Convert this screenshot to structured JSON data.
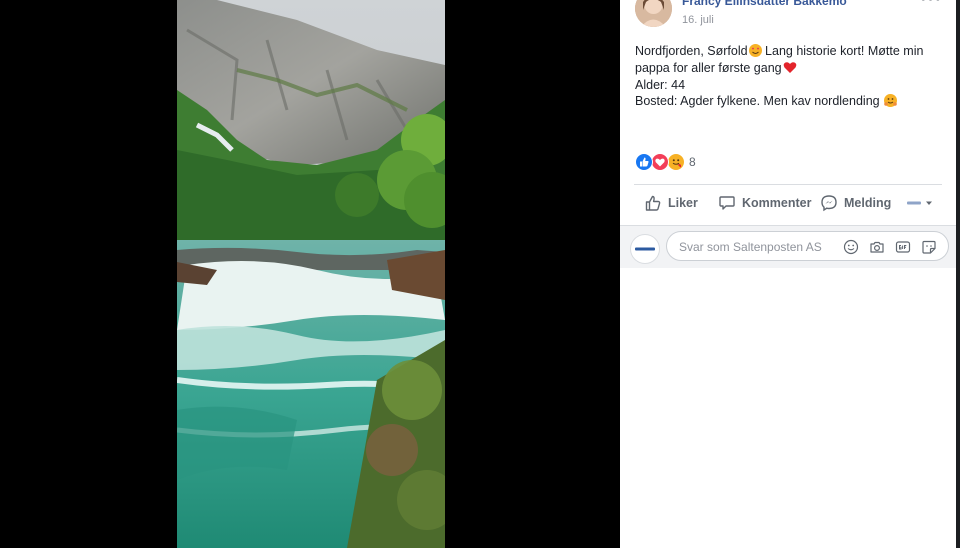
{
  "post": {
    "author": "Francy Ellinsdatter Bakkemo",
    "date": "16. juli",
    "line1_a": "Nordfjorden, Sørfold",
    "line1_b": " Lang historie kort! Møtte min",
    "line2": "pappa for aller første gang",
    "line3": "Alder: 44",
    "line4": "Bosted: Agder fylkene. Men kav nordlending"
  },
  "reactions": {
    "count": "8"
  },
  "actions": {
    "like": "Liker",
    "comment": "Kommenter",
    "message": "Melding"
  },
  "composer": {
    "placeholder": "Svar som Saltenposten AS"
  },
  "icons": {
    "more": "more-options-icon",
    "like": "thumbs-up-icon",
    "comment": "comment-icon",
    "message": "messenger-icon",
    "emoji": "emoji-icon",
    "camera": "camera-icon",
    "gif": "gif-icon",
    "sticker": "sticker-icon"
  },
  "colors": {
    "link": "#385898",
    "like_blue": "#1877f2",
    "love_red": "#f33e58",
    "haha_yellow": "#f7b125"
  }
}
